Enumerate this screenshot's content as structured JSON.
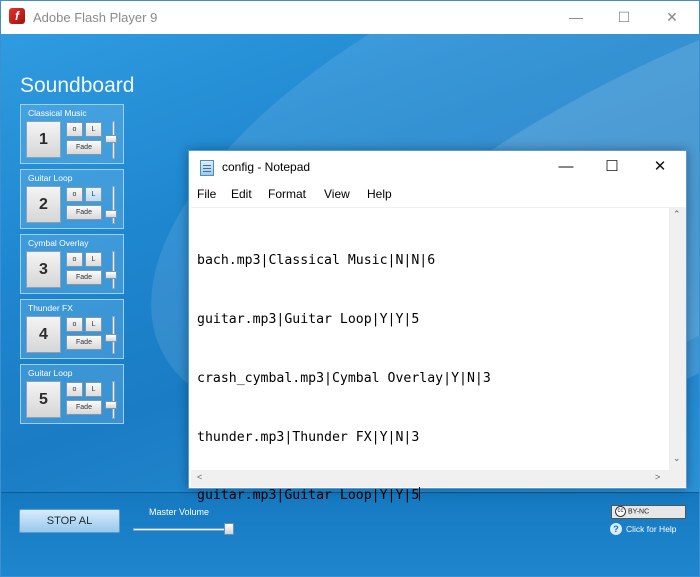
{
  "flash_window": {
    "title": "Adobe Flash Player 9",
    "controls": {
      "minimize": "—",
      "maximize": "☐",
      "close": "✕"
    }
  },
  "soundboard": {
    "title": "Soundboard",
    "pads": [
      {
        "label": "Classical Music",
        "number": "1",
        "o_label": "o",
        "l_label": "L",
        "l_active": false,
        "fade_label": "Fade",
        "volume": 0.55
      },
      {
        "label": "Guitar Loop",
        "number": "2",
        "o_label": "o",
        "l_label": "L",
        "l_active": true,
        "fade_label": "Fade",
        "volume": 0.2
      },
      {
        "label": "Cymbal Overlay",
        "number": "3",
        "o_label": "o",
        "l_label": "L",
        "l_active": false,
        "fade_label": "Fade",
        "volume": 0.35
      },
      {
        "label": "Thunder FX",
        "number": "4",
        "o_label": "o",
        "l_label": "L",
        "l_active": false,
        "fade_label": "Fade",
        "volume": 0.4
      },
      {
        "label": "Guitar Loop",
        "number": "5",
        "o_label": "o",
        "l_label": "L",
        "l_active": false,
        "fade_label": "Fade",
        "volume": 0.35
      }
    ],
    "stop_all_label": "STOP AL",
    "master_volume_label": "Master Volume",
    "master_volume": 0.95,
    "cc_badge": "BY-NC",
    "cc_symbol": "cc",
    "help_link": "Click for Help"
  },
  "notepad": {
    "title": "config - Notepad",
    "menu": [
      "File",
      "Edit",
      "Format",
      "View",
      "Help"
    ],
    "lines": [
      "bach.mp3|Classical Music|N|N|6",
      "guitar.mp3|Guitar Loop|Y|Y|5",
      "crash_cymbal.mp3|Cymbal Overlay|Y|N|3",
      "thunder.mp3|Thunder FX|Y|N|3",
      "guitar.mp3|Guitar Loop|Y|Y|5"
    ],
    "controls": {
      "minimize": "—",
      "maximize": "☐",
      "close": "✕"
    },
    "scroll_up": "⌃",
    "scroll_down": "⌄",
    "scroll_left": "<",
    "scroll_right": ">"
  },
  "colors": {
    "stage_blue": "#1b83c8",
    "notepad_border": "#5b9bd5"
  }
}
